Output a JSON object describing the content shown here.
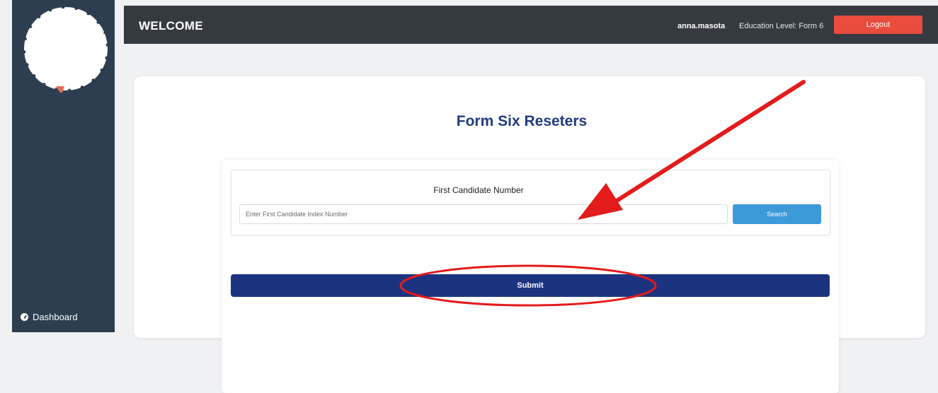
{
  "header": {
    "title": "WELCOME",
    "username": "anna.masota",
    "education_level": "Education Level: Form 6",
    "logout_label": "Logout"
  },
  "sidebar": {
    "items": [
      {
        "label": "Dashboard",
        "icon": "dashboard-icon"
      }
    ]
  },
  "main": {
    "page_title": "Form Six Reseters",
    "candidate_label": "First Candidate Number",
    "index_input": {
      "placeholder": "Enter First Candidate Index Number",
      "value": ""
    },
    "search_label": "Search",
    "submit_label": "Submit"
  },
  "colors": {
    "sidebar": "#2c3e50",
    "topbar": "#343a40",
    "logout": "#e94b3c",
    "search": "#3d9ad9",
    "submit": "#1c3480",
    "title": "#213b7d",
    "annotation": "#e31b1b"
  }
}
